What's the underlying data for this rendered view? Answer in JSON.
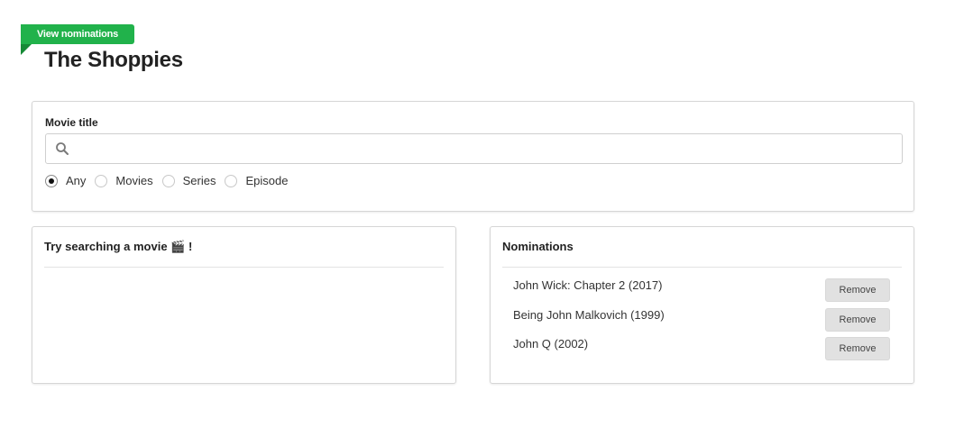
{
  "header": {
    "ribbon_label": "View nominations",
    "title": "The Shoppies"
  },
  "search": {
    "label": "Movie title",
    "value": "",
    "placeholder": "",
    "icon": "search-icon",
    "filters": [
      {
        "label": "Any",
        "selected": true
      },
      {
        "label": "Movies",
        "selected": false
      },
      {
        "label": "Series",
        "selected": false
      },
      {
        "label": "Episode",
        "selected": false
      }
    ]
  },
  "results": {
    "heading": "Try searching a movie 🎬 !"
  },
  "nominations": {
    "heading": "Nominations",
    "items": [
      {
        "title": "John Wick: Chapter 2 (2017)",
        "action": "Remove"
      },
      {
        "title": "Being John Malkovich (1999)",
        "action": "Remove"
      },
      {
        "title": "John Q (2002)",
        "action": "Remove"
      }
    ]
  },
  "colors": {
    "accent": "#21b24b",
    "accent_dark": "#168a36",
    "border": "#d6d6d6",
    "button_bg": "#e1e1e1"
  }
}
